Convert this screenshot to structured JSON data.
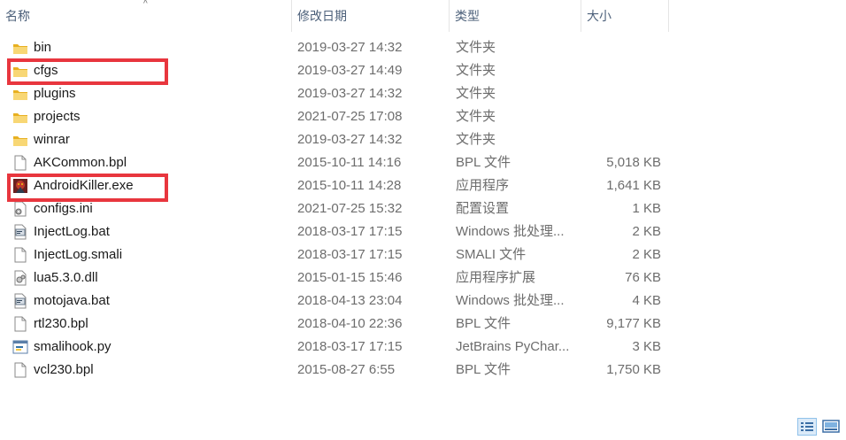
{
  "columns": {
    "name": "名称",
    "date": "修改日期",
    "type": "类型",
    "size": "大小"
  },
  "files": [
    {
      "name": "bin",
      "date": "2019-03-27 14:32",
      "type": "文件夹",
      "size": "",
      "icon": "folder-icon"
    },
    {
      "name": "cfgs",
      "date": "2019-03-27 14:49",
      "type": "文件夹",
      "size": "",
      "icon": "folder-icon"
    },
    {
      "name": "plugins",
      "date": "2019-03-27 14:32",
      "type": "文件夹",
      "size": "",
      "icon": "folder-icon"
    },
    {
      "name": "projects",
      "date": "2021-07-25 17:08",
      "type": "文件夹",
      "size": "",
      "icon": "folder-icon"
    },
    {
      "name": "winrar",
      "date": "2019-03-27 14:32",
      "type": "文件夹",
      "size": "",
      "icon": "folder-icon"
    },
    {
      "name": "AKCommon.bpl",
      "date": "2015-10-11 14:16",
      "type": "BPL 文件",
      "size": "5,018 KB",
      "icon": "file-icon"
    },
    {
      "name": "AndroidKiller.exe",
      "date": "2015-10-11 14:28",
      "type": "应用程序",
      "size": "1,641 KB",
      "icon": "app-icon"
    },
    {
      "name": "configs.ini",
      "date": "2021-07-25 15:32",
      "type": "配置设置",
      "size": "1 KB",
      "icon": "config-file-icon"
    },
    {
      "name": "InjectLog.bat",
      "date": "2018-03-17 17:15",
      "type": "Windows 批处理...",
      "size": "2 KB",
      "icon": "batch-file-icon"
    },
    {
      "name": "InjectLog.smali",
      "date": "2018-03-17 17:15",
      "type": "SMALI 文件",
      "size": "2 KB",
      "icon": "file-icon"
    },
    {
      "name": "lua5.3.0.dll",
      "date": "2015-01-15 15:46",
      "type": "应用程序扩展",
      "size": "76 KB",
      "icon": "dll-file-icon"
    },
    {
      "name": "motojava.bat",
      "date": "2018-04-13 23:04",
      "type": "Windows 批处理...",
      "size": "4 KB",
      "icon": "batch-file-icon"
    },
    {
      "name": "rtl230.bpl",
      "date": "2018-04-10 22:36",
      "type": "BPL 文件",
      "size": "9,177 KB",
      "icon": "file-icon"
    },
    {
      "name": "smalihook.py",
      "date": "2018-03-17 17:15",
      "type": "JetBrains PyChar...",
      "size": "3 KB",
      "icon": "python-file-icon"
    },
    {
      "name": "vcl230.bpl",
      "date": "2015-08-27 6:55",
      "type": "BPL 文件",
      "size": "1,750 KB",
      "icon": "file-icon"
    }
  ],
  "highlighted": [
    "cfgs",
    "AndroidKiller.exe"
  ],
  "colors": {
    "highlight": "#e8363e",
    "folder": "#f4c542",
    "header_text": "#4c607a",
    "secondary_text": "#6d6d6d"
  }
}
